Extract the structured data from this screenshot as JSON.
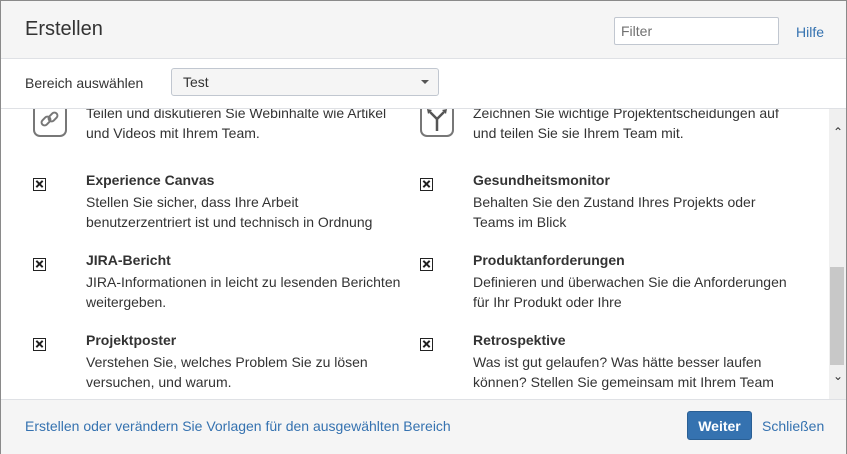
{
  "dialog": {
    "title": "Erstellen",
    "filter_placeholder": "Filter",
    "help_label": "Hilfe"
  },
  "space": {
    "label": "Bereich auswählen",
    "selected": "Test"
  },
  "items": [
    {
      "title": "",
      "description": "Teilen und diskutieren Sie Webinhalte wie Artikel und Videos mit Ihrem Team.",
      "icon": "link-icon"
    },
    {
      "title": "",
      "description": "Zeichnen Sie wichtige Projektentscheidungen auf und teilen Sie sie Ihrem Team mit.",
      "icon": "decision-icon"
    },
    {
      "title": "Experience Canvas",
      "description": "Stellen Sie sicher, dass Ihre Arbeit benutzerzentriert ist und technisch in Ordnung",
      "icon": "broken-image-icon"
    },
    {
      "title": "Gesundheitsmonitor",
      "description": "Behalten Sie den Zustand Ihres Projekts oder Teams im Blick",
      "icon": "broken-image-icon"
    },
    {
      "title": "JIRA-Bericht",
      "description": "JIRA-Informationen in leicht zu lesenden Berichten weitergeben.",
      "icon": "broken-image-icon"
    },
    {
      "title": "Produktanforderungen",
      "description": "Definieren und überwachen Sie die Anforderungen für Ihr Produkt oder Ihre",
      "icon": "broken-image-icon"
    },
    {
      "title": "Projektposter",
      "description": "Verstehen Sie, welches Problem Sie zu lösen versuchen, und warum.",
      "icon": "broken-image-icon"
    },
    {
      "title": "Retrospektive",
      "description": "Was ist gut gelaufen? Was hätte besser laufen können? Stellen Sie gemeinsam mit Ihrem Team",
      "icon": "broken-image-icon"
    }
  ],
  "footer": {
    "templates_link": "Erstellen oder verändern Sie Vorlagen für den ausgewählten Bereich",
    "next_label": "Weiter",
    "close_label": "Schließen"
  },
  "scrollbar": {
    "up_glyph": "⌃",
    "down_glyph": "⌄"
  },
  "colors": {
    "accent": "#3572b0",
    "header_bg": "#f5f5f5",
    "text": "#333333"
  }
}
